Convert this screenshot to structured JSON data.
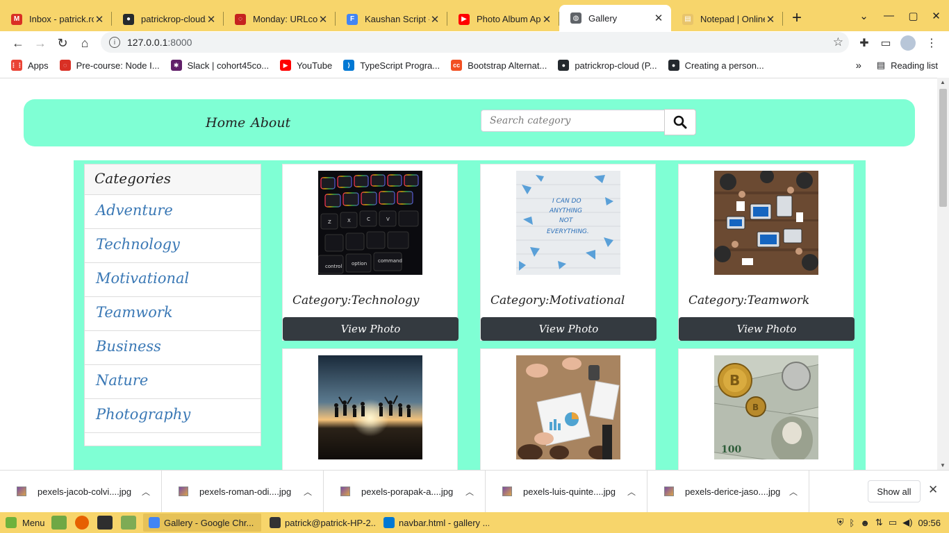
{
  "browser": {
    "tabs": [
      {
        "title": "Inbox - patrick.rop",
        "icon": "gmail-icon",
        "color": "#d93025",
        "glyph": "M"
      },
      {
        "title": "patrickrop-cloud/",
        "icon": "github-icon",
        "color": "#24292e",
        "glyph": "●"
      },
      {
        "title": "Monday: URLconf",
        "icon": "loading-ring-icon",
        "color": "#c5221f",
        "glyph": "◌"
      },
      {
        "title": "Kaushan Script - G",
        "icon": "google-fonts-icon",
        "color": "#4285f4",
        "glyph": "F"
      },
      {
        "title": "Photo Album App",
        "icon": "youtube-icon",
        "color": "#ff0000",
        "glyph": "▶"
      },
      {
        "title": "Gallery",
        "icon": "globe-icon",
        "color": "#5f6368",
        "glyph": "◍",
        "active": true
      },
      {
        "title": "Notepad | Online",
        "icon": "notepad-icon",
        "color": "#e8c46a",
        "glyph": "▤"
      }
    ],
    "url_host": "127.0.0.1",
    "url_port": ":8000",
    "bookmarks": [
      {
        "label": "Apps",
        "color": "#ea4335",
        "glyph": "⋮⋮"
      },
      {
        "label": "Pre-course: Node I...",
        "color": "#d93025",
        "glyph": "◌"
      },
      {
        "label": "Slack | cohort45co...",
        "color": "#611f69",
        "glyph": "✱"
      },
      {
        "label": "YouTube",
        "color": "#ff0000",
        "glyph": "▶"
      },
      {
        "label": "TypeScript Progra...",
        "color": "#0078d4",
        "glyph": "⟩"
      },
      {
        "label": "Bootstrap Alternat...",
        "color": "#f25022",
        "glyph": "cc"
      },
      {
        "label": "patrickrop-cloud (P...",
        "color": "#24292e",
        "glyph": "●"
      },
      {
        "label": "Creating a person...",
        "color": "#24292e",
        "glyph": "●"
      }
    ],
    "more_bookmarks": "»",
    "reading_list": "Reading list"
  },
  "page": {
    "nav": {
      "home": "Home",
      "about": "About",
      "search_placeholder": "Search category"
    },
    "sidebar": {
      "heading": "Categories",
      "items": [
        "Adventure",
        "Technology",
        "Motivational",
        "Teamwork",
        "Business",
        "Nature",
        "Photography"
      ]
    },
    "cards": [
      {
        "category": "Category:Technology",
        "button": "View Photo"
      },
      {
        "category": "Category:Motivational",
        "button": "View Photo"
      },
      {
        "category": "Category:Teamwork",
        "button": "View Photo"
      },
      {
        "category": "",
        "button": ""
      },
      {
        "category": "",
        "button": ""
      },
      {
        "category": "",
        "button": ""
      }
    ],
    "photo_text": "I CAN DO ANYTHING NOT EVERYTHING."
  },
  "downloads": {
    "items": [
      "pexels-jacob-colvi....jpg",
      "pexels-roman-odi....jpg",
      "pexels-porapak-a....jpg",
      "pexels-luis-quinte....jpg",
      "pexels-derice-jaso....jpg"
    ],
    "show_all": "Show all"
  },
  "taskbar": {
    "menu": "Menu",
    "windows": [
      {
        "label": "Gallery - Google Chr...",
        "color": "#4285f4",
        "active": true
      },
      {
        "label": "patrick@patrick-HP-2...",
        "color": "#333333"
      },
      {
        "label": "navbar.html - gallery ...",
        "color": "#0078d4"
      }
    ],
    "clock": "09:56"
  }
}
